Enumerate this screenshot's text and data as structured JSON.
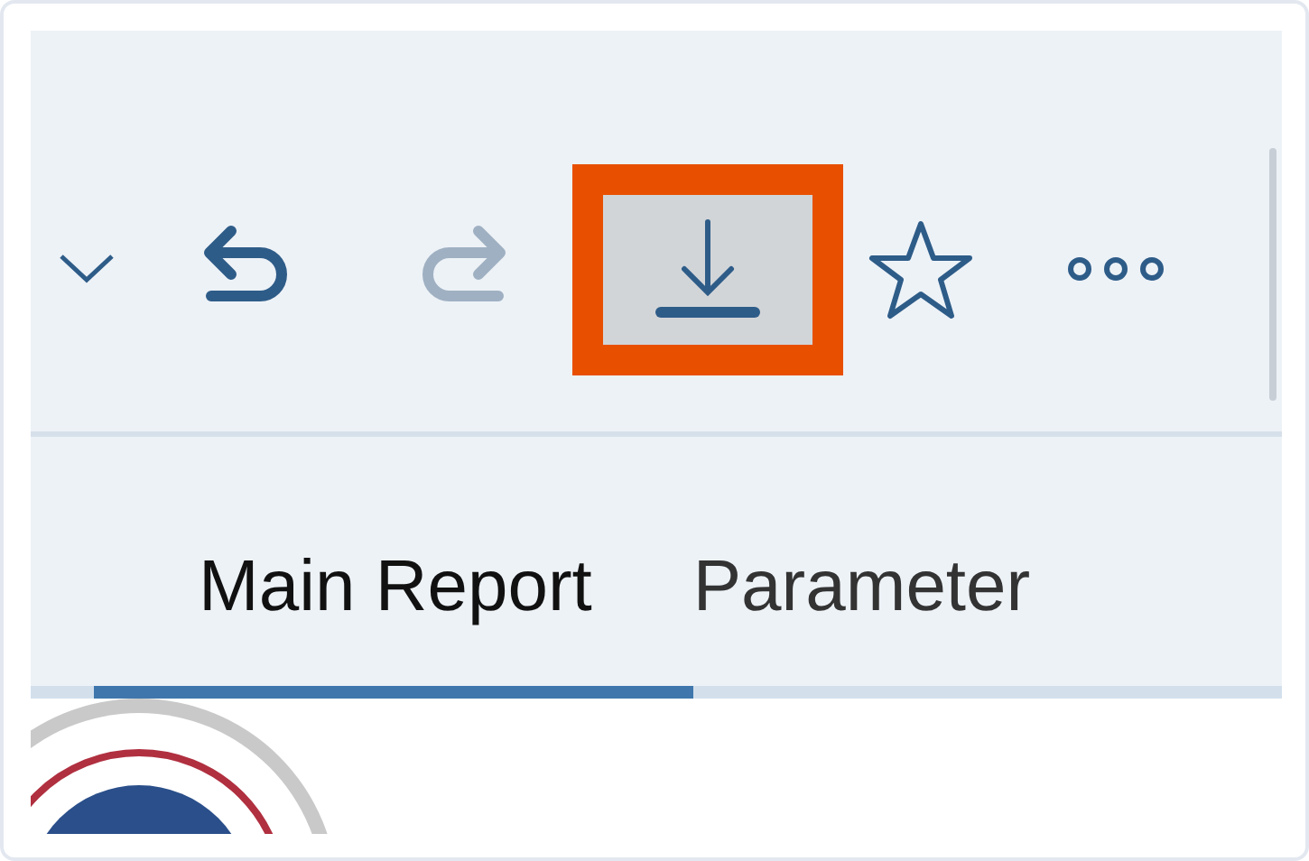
{
  "toolbar": {
    "buttons": [
      {
        "kind": "dropdown",
        "disabled": false,
        "highlighted": false
      },
      {
        "kind": "undo",
        "disabled": false,
        "highlighted": false
      },
      {
        "kind": "redo",
        "disabled": true,
        "highlighted": false
      },
      {
        "kind": "download",
        "disabled": false,
        "highlighted": true
      },
      {
        "kind": "favorite",
        "disabled": false,
        "highlighted": false
      },
      {
        "kind": "more",
        "disabled": false,
        "highlighted": false
      }
    ]
  },
  "tabs": [
    {
      "label": "Main Report",
      "selected": true
    },
    {
      "label": "Parameter",
      "selected": false
    }
  ]
}
